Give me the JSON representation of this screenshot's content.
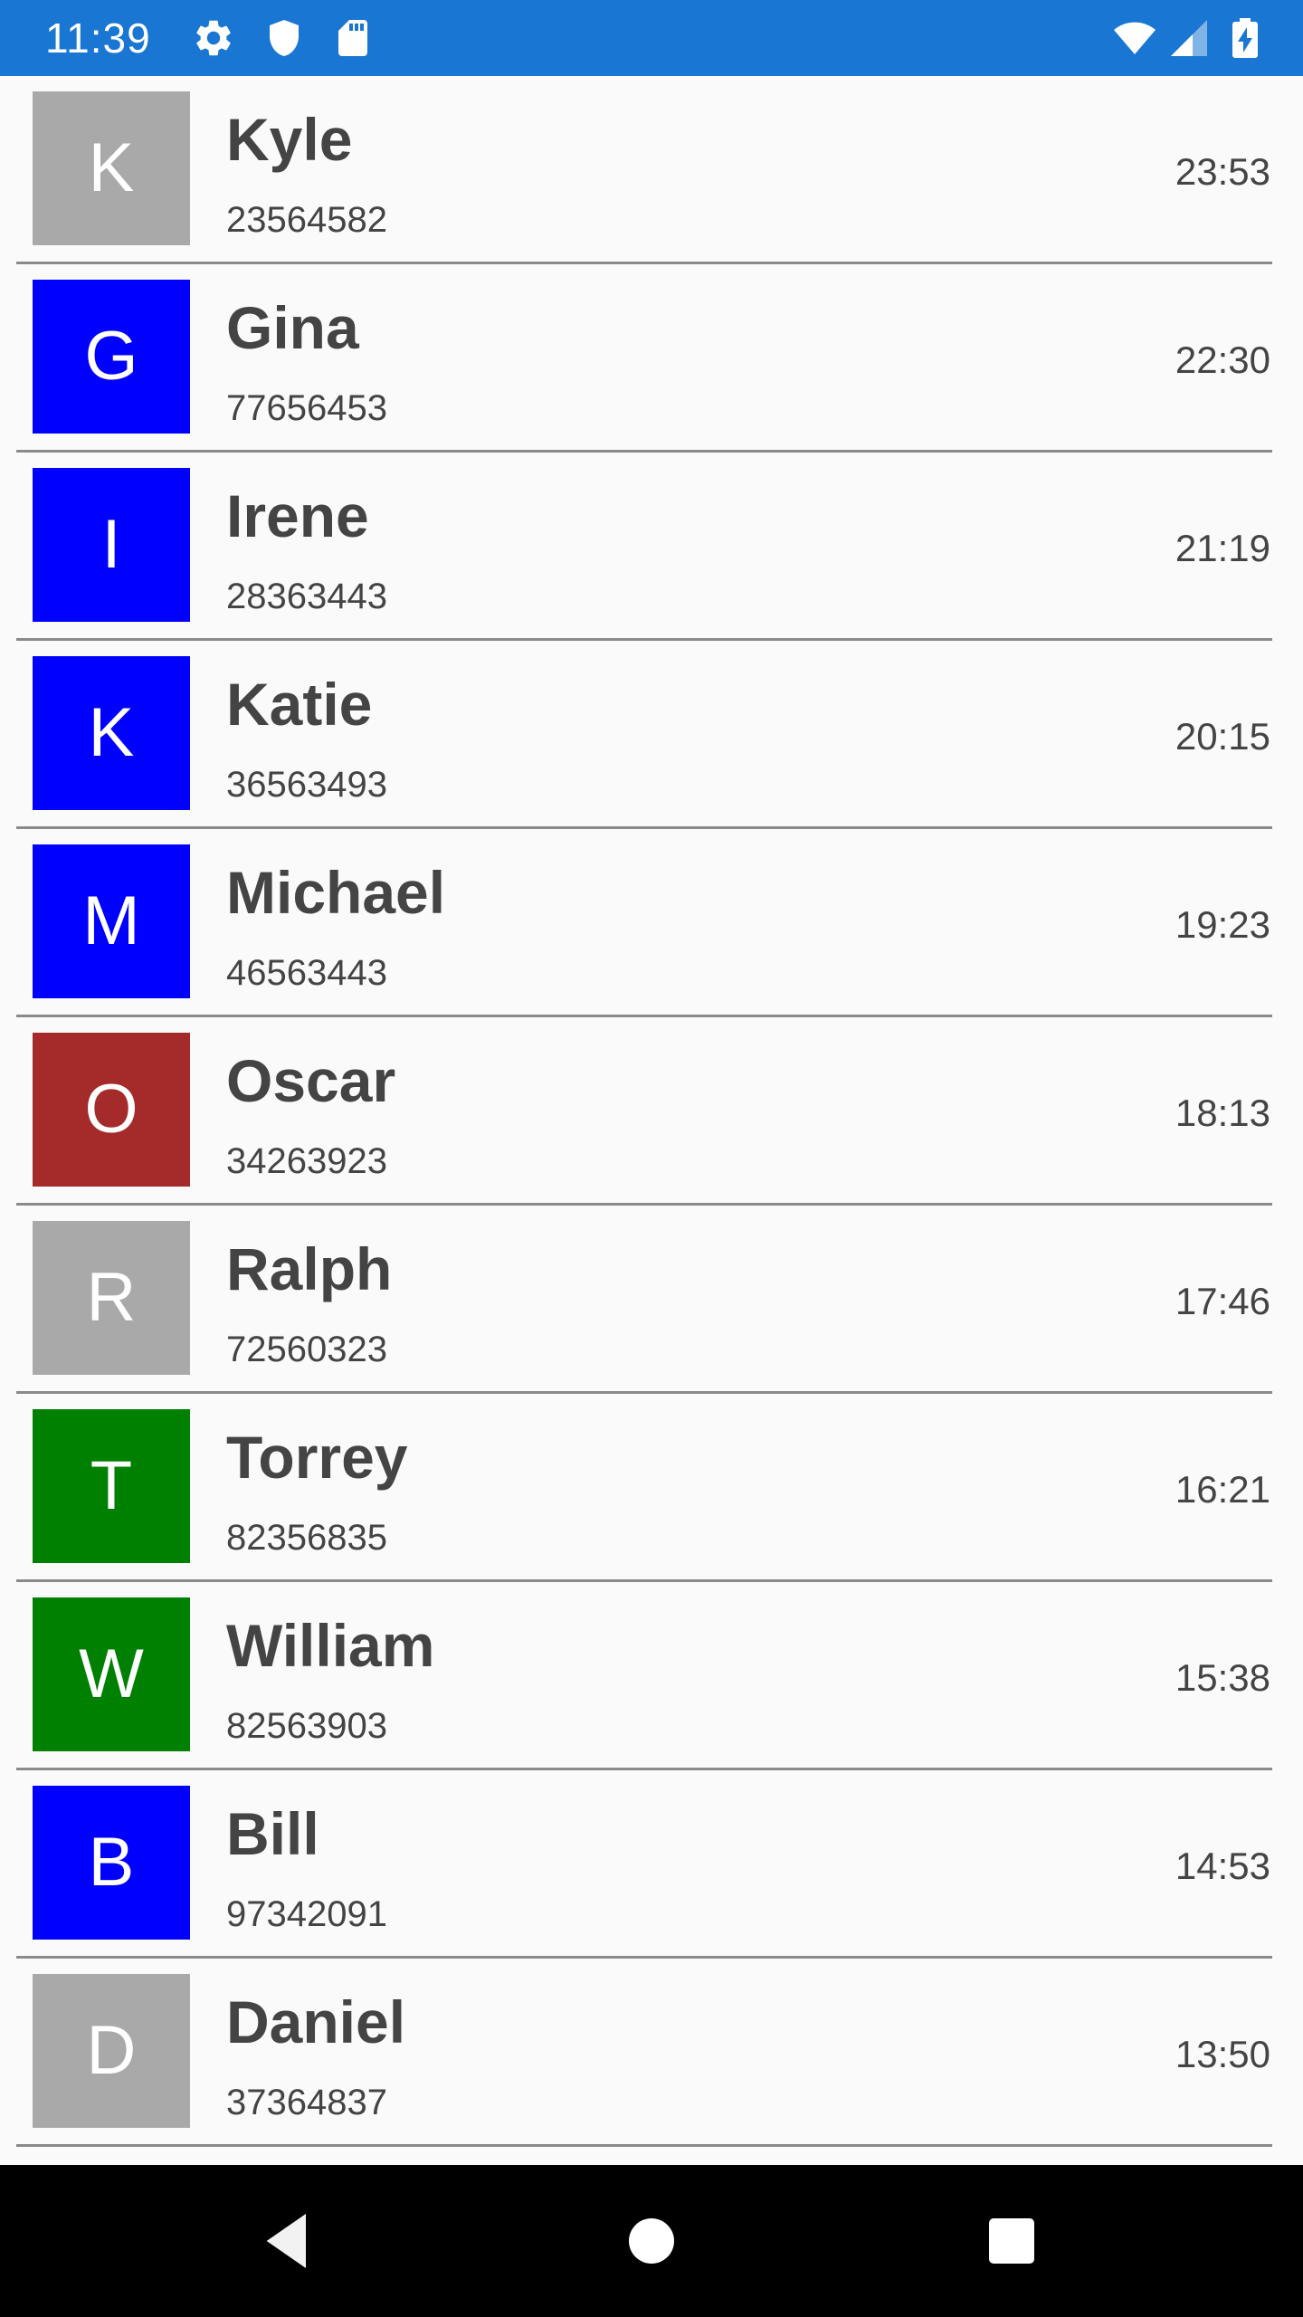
{
  "status_bar": {
    "time": "11:39",
    "background": "#1976d2",
    "icons": [
      "gear-icon",
      "shield-icon",
      "sd-card-icon",
      "wifi-icon",
      "signal-icon",
      "battery-charging-icon"
    ]
  },
  "contacts": [
    {
      "initial": "K",
      "name": "Kyle",
      "phone": "23564582",
      "time": "23:53",
      "color": "#a9a9a9"
    },
    {
      "initial": "G",
      "name": "Gina",
      "phone": "77656453",
      "time": "22:30",
      "color": "#0000ff"
    },
    {
      "initial": "I",
      "name": "Irene",
      "phone": "28363443",
      "time": "21:19",
      "color": "#0000ff"
    },
    {
      "initial": "K",
      "name": "Katie",
      "phone": "36563493",
      "time": "20:15",
      "color": "#0000ff"
    },
    {
      "initial": "M",
      "name": "Michael",
      "phone": "46563443",
      "time": "19:23",
      "color": "#0000ff"
    },
    {
      "initial": "O",
      "name": "Oscar",
      "phone": "34263923",
      "time": "18:13",
      "color": "#a52a2a"
    },
    {
      "initial": "R",
      "name": "Ralph",
      "phone": "72560323",
      "time": "17:46",
      "color": "#a9a9a9"
    },
    {
      "initial": "T",
      "name": "Torrey",
      "phone": "82356835",
      "time": "16:21",
      "color": "#008000"
    },
    {
      "initial": "W",
      "name": "William",
      "phone": "82563903",
      "time": "15:38",
      "color": "#008000"
    },
    {
      "initial": "B",
      "name": "Bill",
      "phone": "97342091",
      "time": "14:53",
      "color": "#0000ff"
    },
    {
      "initial": "D",
      "name": "Daniel",
      "phone": "37364837",
      "time": "13:50",
      "color": "#a9a9a9"
    }
  ],
  "nav_bar": {
    "buttons": [
      "back-icon",
      "home-icon",
      "recents-icon"
    ]
  }
}
